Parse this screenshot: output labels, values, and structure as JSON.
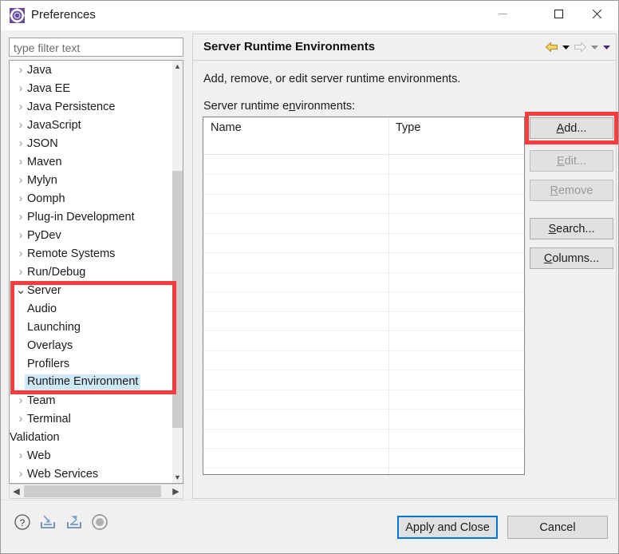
{
  "window": {
    "title": "Preferences",
    "icon": "preferences-gear-icon",
    "controls": {
      "minimize": "minimize-icon",
      "maximize": "maximize-icon",
      "close": "close-icon"
    }
  },
  "filter": {
    "placeholder": "type filter text",
    "value": ""
  },
  "tree": {
    "items": [
      {
        "label": "Java",
        "twisty": "collapsed",
        "level": 0
      },
      {
        "label": "Java EE",
        "twisty": "collapsed",
        "level": 0
      },
      {
        "label": "Java Persistence",
        "twisty": "collapsed",
        "level": 0
      },
      {
        "label": "JavaScript",
        "twisty": "collapsed",
        "level": 0
      },
      {
        "label": "JSON",
        "twisty": "collapsed",
        "level": 0
      },
      {
        "label": "Maven",
        "twisty": "collapsed",
        "level": 0
      },
      {
        "label": "Mylyn",
        "twisty": "collapsed",
        "level": 0
      },
      {
        "label": "Oomph",
        "twisty": "collapsed",
        "level": 0
      },
      {
        "label": "Plug-in Development",
        "twisty": "collapsed",
        "level": 0
      },
      {
        "label": "PyDev",
        "twisty": "collapsed",
        "level": 0
      },
      {
        "label": "Remote Systems",
        "twisty": "collapsed",
        "level": 0
      },
      {
        "label": "Run/Debug",
        "twisty": "collapsed",
        "level": 0
      },
      {
        "label": "Server",
        "twisty": "expanded",
        "level": 0
      },
      {
        "label": "Audio",
        "twisty": "none",
        "level": 1
      },
      {
        "label": "Launching",
        "twisty": "none",
        "level": 1
      },
      {
        "label": "Overlays",
        "twisty": "none",
        "level": 1
      },
      {
        "label": "Profilers",
        "twisty": "none",
        "level": 1
      },
      {
        "label": "Runtime Environment",
        "twisty": "none",
        "level": 1,
        "selected": true
      },
      {
        "label": "Team",
        "twisty": "collapsed",
        "level": 0
      },
      {
        "label": "Terminal",
        "twisty": "collapsed",
        "level": 0
      },
      {
        "label": "Validation",
        "twisty": "none",
        "level": 0
      },
      {
        "label": "Web",
        "twisty": "collapsed",
        "level": 0
      },
      {
        "label": "Web Services",
        "twisty": "collapsed",
        "level": 0
      }
    ],
    "selected_label": "Runtime Environment",
    "scrollbar_vertical": {
      "up": "chevron-up-icon",
      "down": "chevron-down-icon"
    },
    "scrollbar_horizontal": {
      "left": "chevron-left-icon",
      "right": "chevron-right-icon"
    }
  },
  "page": {
    "title": "Server Runtime Environments",
    "description": "Add, remove, or edit server runtime environments.",
    "list_label_pre": "Server runtime e",
    "list_label_mnemonic": "n",
    "list_label_post": "vironments:",
    "nav": {
      "back": "back-arrow-icon",
      "back_menu": "back-dropdown-icon",
      "forward": "forward-arrow-icon",
      "forward_menu": "forward-dropdown-icon",
      "view_menu": "view-menu-dropdown-icon"
    }
  },
  "table": {
    "columns": [
      "Name",
      "Type"
    ],
    "rows": []
  },
  "side_buttons": [
    {
      "name": "add",
      "pre": "",
      "mnemonic": "A",
      "post": "dd...",
      "enabled": true,
      "highlighted": true
    },
    {
      "name": "edit",
      "pre": "",
      "mnemonic": "E",
      "post": "dit...",
      "enabled": false,
      "highlighted": false
    },
    {
      "name": "remove",
      "pre": "",
      "mnemonic": "R",
      "post": "emove",
      "enabled": false,
      "highlighted": false
    },
    {
      "name": "search",
      "pre": "",
      "mnemonic": "S",
      "post": "earch...",
      "enabled": true,
      "highlighted": false
    },
    {
      "name": "columns",
      "pre": "",
      "mnemonic": "C",
      "post": "olumns...",
      "enabled": true,
      "highlighted": false
    }
  ],
  "footer": {
    "icons": [
      "help-icon",
      "import-icon",
      "export-icon",
      "restore-defaults-icon"
    ],
    "apply_label": "Apply and Close",
    "cancel_label": "Cancel"
  },
  "colors": {
    "accent_focus": "#0078d7",
    "annotation_red": "#fa3c3c",
    "selection_blue": "#cde8f6",
    "dialog_bg": "#f0f0f0",
    "button_bg": "#e1e1e1"
  }
}
